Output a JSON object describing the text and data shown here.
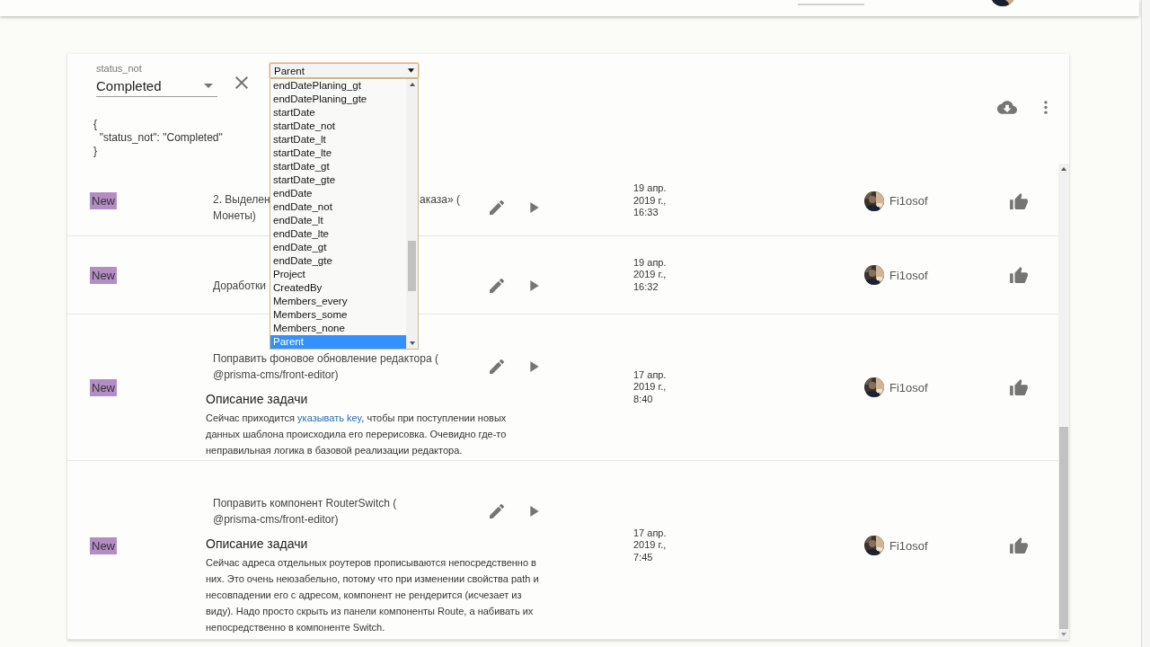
{
  "filter": {
    "field_label": "status_not",
    "value": "Completed",
    "json_preview": "{\n  \"status_not\": \"Completed\"\n}"
  },
  "field_select": {
    "value": "Parent",
    "options": [
      {
        "label": "endDatePlaning_gt",
        "selected": false
      },
      {
        "label": "endDatePlaning_gte",
        "selected": false
      },
      {
        "label": "startDate",
        "selected": false
      },
      {
        "label": "startDate_not",
        "selected": false
      },
      {
        "label": "startDate_lt",
        "selected": false
      },
      {
        "label": "startDate_lte",
        "selected": false
      },
      {
        "label": "startDate_gt",
        "selected": false
      },
      {
        "label": "startDate_gte",
        "selected": false
      },
      {
        "label": "endDate",
        "selected": false
      },
      {
        "label": "endDate_not",
        "selected": false
      },
      {
        "label": "endDate_lt",
        "selected": false
      },
      {
        "label": "endDate_lte",
        "selected": false
      },
      {
        "label": "endDate_gt",
        "selected": false
      },
      {
        "label": "endDate_gte",
        "selected": false
      },
      {
        "label": "Project",
        "selected": false
      },
      {
        "label": "CreatedBy",
        "selected": false
      },
      {
        "label": "Members_every",
        "selected": false
      },
      {
        "label": "Members_some",
        "selected": false
      },
      {
        "label": "Members_none",
        "selected": false
      },
      {
        "label": "Parent",
        "selected": true
      }
    ]
  },
  "tasks": [
    {
      "status": "New",
      "title": [
        [
          "2. Выделен",
          "аказа» ("
        ],
        [
          "Монеты)"
        ]
      ],
      "date": "19 апр.\n2019 г.,\n16:33",
      "author": "Fi1osof"
    },
    {
      "status": "New",
      "title": [
        [
          "Доработки"
        ]
      ],
      "date": "19 апр.\n2019 г.,\n16:32",
      "author": "Fi1osof"
    },
    {
      "status": "New",
      "title": [
        [
          "Поправить фоновое обновление редактора ("
        ],
        [
          "@prisma-cms/front-editor)"
        ]
      ],
      "description": {
        "heading": "Описание задачи",
        "lines": [
          [
            {
              "text": "Сейчас приходится ",
              "link": false
            },
            {
              "text": "указывать key",
              "link": true
            },
            {
              "text": ", чтобы при поступлении новых",
              "link": false
            }
          ],
          [
            {
              "text": "данных шаблона происходила его перерисовка. Очевидно где-то",
              "link": false
            }
          ],
          [
            {
              "text": "неправильная логика в базовой реализации редактора.",
              "link": false
            }
          ]
        ]
      },
      "date": "17 апр.\n2019 г.,\n8:40",
      "author": "Fi1osof"
    },
    {
      "status": "New",
      "title": [
        [
          "Поправить компонент RouterSwitch ("
        ],
        [
          "@prisma-cms/front-editor)"
        ]
      ],
      "description": {
        "heading": "Описание задачи",
        "lines": [
          [
            {
              "text": "Сейчас адреса отдельных роутеров прописываются непосредственно в",
              "link": false
            }
          ],
          [
            {
              "text": "них. Это очень неюзабельно, потому что при изменении свойства path и",
              "link": false
            }
          ],
          [
            {
              "text": "несовпадении его с адресом, компонент не рендерится (исчезает из",
              "link": false
            }
          ],
          [
            {
              "text": "виду). Надо просто скрыть из панели компоненты Route, а набивать их",
              "link": false
            }
          ],
          [
            {
              "text": "непосредственно в компоненте Switch.",
              "link": false
            }
          ]
        ]
      },
      "date": "17 апр.\n2019 г.,\n7:45",
      "author": "Fi1osof"
    }
  ]
}
